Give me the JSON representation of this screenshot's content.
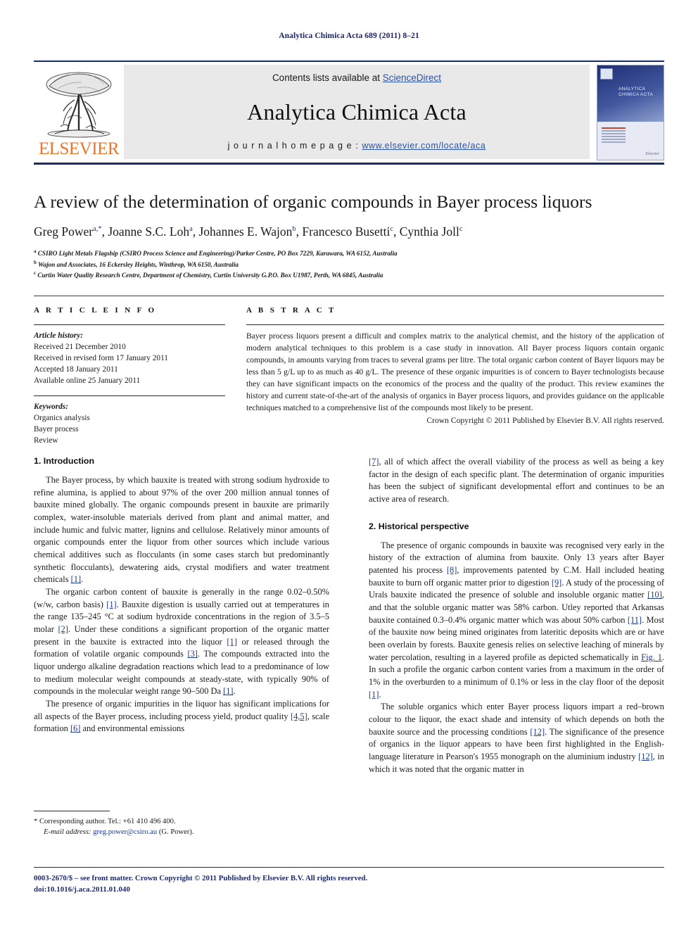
{
  "running_head": "Analytica Chimica Acta 689 (2011) 8–21",
  "masthead": {
    "contents_prefix": "Contents lists available at ",
    "sciencedirect": "ScienceDirect",
    "journal_name": "Analytica Chimica Acta",
    "homepage_prefix": "j o u r n a l   h o m e p a g e :",
    "homepage_url": "www.elsevier.com/locate/aca",
    "publisher_wordmark": "ELSEVIER",
    "cover_title": "ANALYTICA CHIMICA ACTA",
    "cover_publisher": "Elsevier"
  },
  "article": {
    "title": "A review of the determination of organic compounds in Bayer process liquors",
    "authors_html": "Greg Power<sup>a,*</sup>, Joanne S.C. Loh<sup>a</sup>, Johannes E. Wajon<sup>b</sup>, Francesco Busetti<sup>c</sup>, Cynthia Joll<sup>c</sup>",
    "affiliations": [
      "CSIRO Light Metals Flagship (CSIRO Process Science and Engineering)/Parker Centre, PO Box 7229, Karawara, WA 6152, Australia",
      "Wajon and Associates, 16 Eckersley Heights, Winthrop, WA 6150, Australia",
      "Curtin Water Quality Research Centre, Department of Chemistry, Curtin University G.P.O. Box U1987, Perth, WA 6845, Australia"
    ],
    "affiliation_marks": [
      "a",
      "b",
      "c"
    ]
  },
  "info": {
    "heading": "A R T I C L E   I N F O",
    "history_label": "Article history:",
    "history": [
      "Received 21 December 2010",
      "Received in revised form 17 January 2011",
      "Accepted 18 January 2011",
      "Available online 25 January 2011"
    ],
    "keywords_label": "Keywords:",
    "keywords": [
      "Organics analysis",
      "Bayer process",
      "Review"
    ]
  },
  "abstract": {
    "heading": "A B S T R A C T",
    "text": "Bayer process liquors present a difficult and complex matrix to the analytical chemist, and the history of the application of modern analytical techniques to this problem is a case study in innovation. All Bayer process liquors contain organic compounds, in amounts varying from traces to several grams per litre. The total organic carbon content of Bayer liquors may be less than 5 g/L up to as much as 40 g/L. The presence of these organic impurities is of concern to Bayer technologists because they can have significant impacts on the economics of the process and the quality of the product. This review examines the history and current state-of-the-art of the analysis of organics in Bayer process liquors, and provides guidance on the applicable techniques matched to a comprehensive list of the compounds most likely to be present.",
    "copyright": "Crown Copyright © 2011 Published by Elsevier B.V. All rights reserved."
  },
  "sections": {
    "introduction_title": "1.  Introduction",
    "historical_title": "2.  Historical perspective"
  },
  "body": {
    "p1_a": "The Bayer process, by which bauxite is treated with strong sodium hydroxide to refine alumina, is applied to about 97% of the over 200 million annual tonnes of bauxite mined globally. The organic compounds present in bauxite are primarily complex, water-insoluble materials derived from plant and animal matter, and include humic and fulvic matter, lignins and cellulose. Relatively minor amounts of organic compounds enter the liquor from other sources which include various chemical additives such as flocculants (in some cases starch but predominantly synthetic flocculants), dewatering aids, crystal modifiers and water treatment chemicals ",
    "p1_ref": "[1]",
    "p1_b": ".",
    "p2_a": "The organic carbon content of bauxite is generally in the range 0.02–0.50% (w/w, carbon basis) ",
    "p2_r1": "[1]",
    "p2_b": ". Bauxite digestion is usually carried out at temperatures in the range 135–245 °C at sodium hydroxide concentrations in the region of 3.5–5 molar ",
    "p2_r2": "[2]",
    "p2_c": ". Under these conditions a significant proportion of the organic matter present in the bauxite is extracted into the liquor ",
    "p2_r3": "[1]",
    "p2_d": " or released through the formation of volatile organic compounds ",
    "p2_r4": "[3]",
    "p2_e": ". The compounds extracted into the liquor undergo alkaline degradation reactions which lead to a predominance of low to medium molecular weight compounds at steady-state, with typically 90% of compounds in the molecular weight range 90–500 Da ",
    "p2_r5": "[1]",
    "p2_f": ".",
    "p3_a": "The presence of organic impurities in the liquor has significant implications for all aspects of the Bayer process, including process yield, product quality ",
    "p3_r1": "[4,5]",
    "p3_b": ", scale formation ",
    "p3_r2": "[6]",
    "p3_c": " and environmental emissions ",
    "p3_r3": "[7]",
    "p3_d": ", all of which affect the overall viability of the process as well as being a key factor in the design of each specific plant. The determination of organic impurities has been the subject of significant developmental effort and continues to be an active area of research.",
    "p4_a": "The presence of organic compounds in bauxite was recognised very early in the history of the extraction of alumina from bauxite. Only 13 years after Bayer patented his process ",
    "p4_r1": "[8]",
    "p4_b": ", improvements patented by C.M. Hall included heating bauxite to burn off organic matter prior to digestion ",
    "p4_r2": "[9]",
    "p4_c": ". A study of the processing of Urals bauxite indicated the presence of soluble and insoluble organic matter ",
    "p4_r3": "[10]",
    "p4_d": ", and that the soluble organic matter was 58% carbon. Utley reported that Arkansas bauxite contained 0.3–0.4% organic matter which was about 50% carbon ",
    "p4_r4": "[11]",
    "p4_e": ". Most of the bauxite now being mined originates from lateritic deposits which are or have been overlain by forests. Bauxite genesis relies on selective leaching of minerals by water percolation, resulting in a layered profile as depicted schematically in ",
    "p4_r5": "Fig. 1",
    "p4_f": ". In such a profile the organic carbon content varies from a maximum in the order of 1% in the overburden to a minimum of 0.1% or less in the clay floor of the deposit ",
    "p4_r6": "[1]",
    "p4_g": ".",
    "p5_a": "The soluble organics which enter Bayer process liquors impart a red–brown colour to the liquor, the exact shade and intensity of which depends on both the bauxite source and the processing conditions ",
    "p5_r1": "[12]",
    "p5_b": ". The significance of the presence of organics in the liquor appears to have been first highlighted in the English-language literature in Pearson's 1955 monograph on the aluminium industry ",
    "p5_r2": "[12]",
    "p5_c": ", in which it was noted that the organic matter in"
  },
  "footnote": {
    "corresponding": "* Corresponding author. Tel.: +61 410 496 400.",
    "email_label": "E-mail address:",
    "email": "greg.power@csiro.au",
    "email_owner": "(G. Power)."
  },
  "bottom": {
    "issn_line": "0003-2670/$ – see front matter. Crown Copyright © 2011 Published by Elsevier B.V. All rights reserved.",
    "doi_line": "doi:10.1016/j.aca.2011.01.040"
  }
}
